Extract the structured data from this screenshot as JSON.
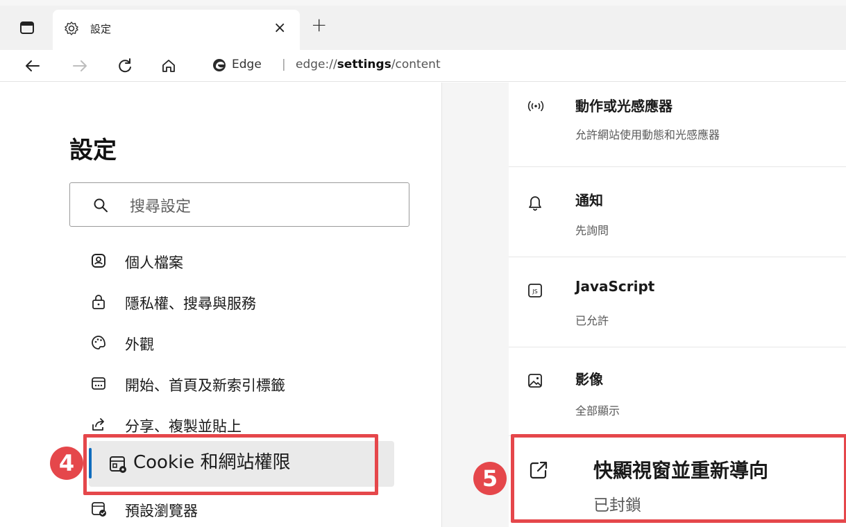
{
  "browser": {
    "tab": {
      "title": "設定",
      "close": "×"
    },
    "new_tab": "+",
    "address": {
      "brand": "Edge",
      "separator": "|",
      "url_prefix": "edge://",
      "url_bold": "settings",
      "url_suffix": "/content"
    }
  },
  "sidebar": {
    "title": "設定",
    "search_placeholder": "搜尋設定",
    "items": [
      {
        "label": "個人檔案",
        "icon": "profile-icon"
      },
      {
        "label": "隱私權、搜尋與服務",
        "icon": "lock-icon"
      },
      {
        "label": "外觀",
        "icon": "palette-icon"
      },
      {
        "label": "開始、首頁及新索引標籤",
        "icon": "home-grid-icon"
      },
      {
        "label": "分享、複製並貼上",
        "icon": "share-icon"
      },
      {
        "label": "Cookie 和網站權限",
        "icon": "site-permissions-icon",
        "selected": true
      },
      {
        "label": "預設瀏覽器",
        "icon": "default-browser-icon"
      }
    ]
  },
  "permissions": [
    {
      "title": "動作或光感應器",
      "subtitle": "允許網站使用動態和光感應器",
      "icon": "sensor-icon"
    },
    {
      "title": "通知",
      "subtitle": "先詢問",
      "icon": "bell-icon"
    },
    {
      "title": "JavaScript",
      "subtitle": "已允許",
      "icon": "js-icon"
    },
    {
      "title": "影像",
      "subtitle": "全部顯示",
      "icon": "image-icon"
    },
    {
      "title": "快顯視窗並重新導向",
      "subtitle": "已封鎖",
      "icon": "popup-icon"
    }
  ],
  "annotations": {
    "step4": "4",
    "step5": "5",
    "color": "#e5474b"
  },
  "colors": {
    "accent": "#0f6cbd"
  }
}
